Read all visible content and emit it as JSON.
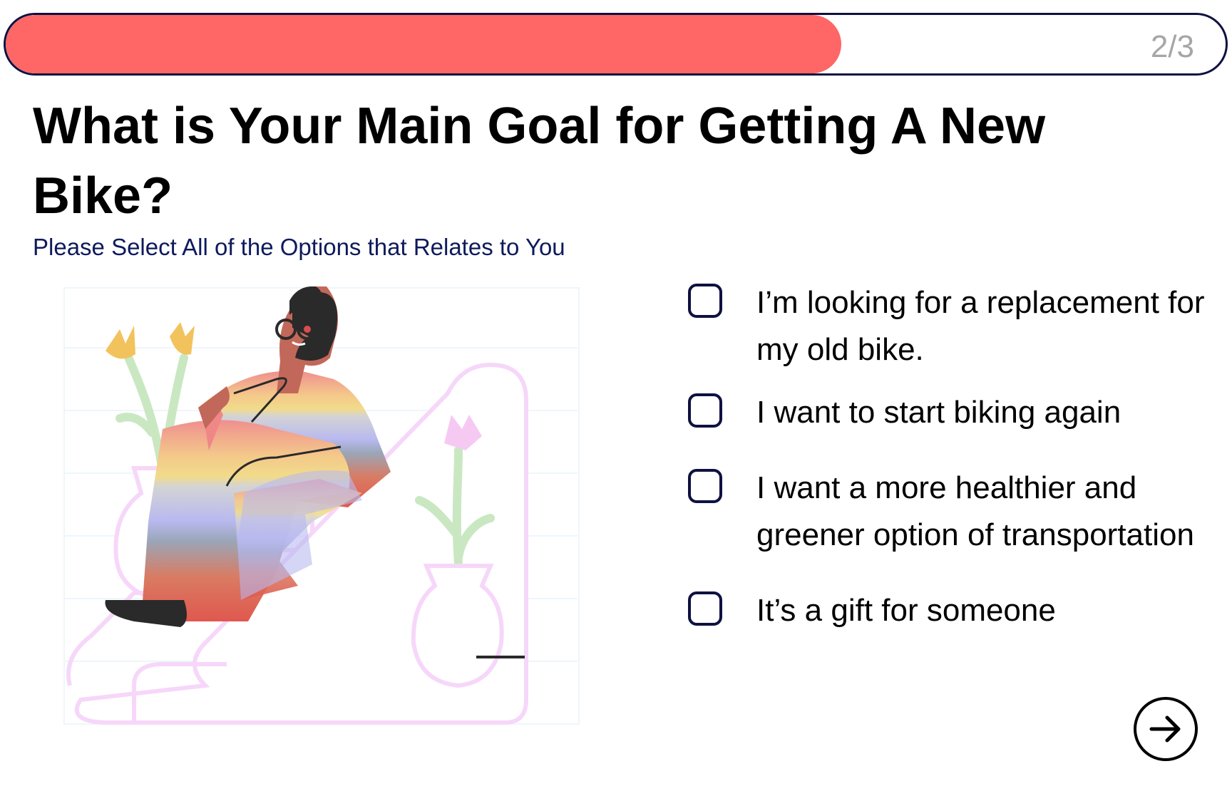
{
  "progress": {
    "label": "2/3",
    "fraction": 0.685,
    "fill_color": "#ff6666",
    "border_color": "#0e1140"
  },
  "question": {
    "title": "What is Your Main Goal for Getting A New Bike?",
    "subtitle": "Please Select All of the Options that Relates to You"
  },
  "illustration": {
    "icon": "person-sitting-on-stairs-illustration"
  },
  "options": [
    {
      "label": "I’m looking for a replacement for my old bike.",
      "checked": false
    },
    {
      "label": "I want to start biking again",
      "checked": false
    },
    {
      "label": "I want a more healthier and greener option of transportation",
      "checked": false
    },
    {
      "label": "It’s a gift for someone",
      "checked": false
    }
  ],
  "next_button": {
    "icon": "arrow-right-icon"
  }
}
